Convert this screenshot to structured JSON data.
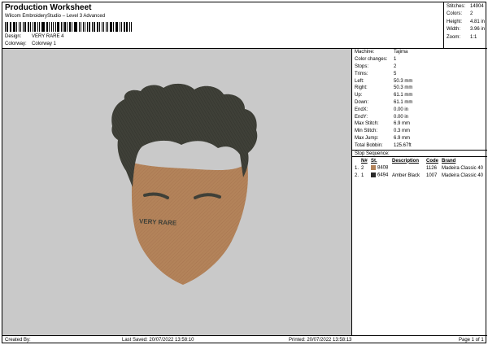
{
  "header": {
    "title": "Production Worksheet",
    "subtitle": "Wilcom EmbroideryStudio – Level 3 Advanced",
    "design_label": "Design:",
    "design_value": "VERY RARE 4",
    "colorway_label": "Colorway:",
    "colorway_value": "Colorway 1"
  },
  "summary": [
    {
      "label": "Stitches:",
      "value": "14904"
    },
    {
      "label": "Colors:",
      "value": "2"
    },
    {
      "label": "Height:",
      "value": "4.81 in"
    },
    {
      "label": "Width:",
      "value": "3.96 in"
    },
    {
      "label": "Zoom:",
      "value": "1:1"
    }
  ],
  "details": [
    {
      "label": "Machine:",
      "value": "Tajima"
    },
    {
      "label": "Color changes:",
      "value": "1"
    },
    {
      "label": "Stops:",
      "value": "2"
    },
    {
      "label": "Trims:",
      "value": "5"
    },
    {
      "label": "Left:",
      "value": "50.3 mm"
    },
    {
      "label": "Right:",
      "value": "50.3 mm"
    },
    {
      "label": "Up:",
      "value": "61.1 mm"
    },
    {
      "label": "Down:",
      "value": "61.1 mm"
    },
    {
      "label": "EndX:",
      "value": "0.00 in"
    },
    {
      "label": "EndY:",
      "value": "0.00 in"
    },
    {
      "label": "Max Stitch:",
      "value": "6.9 mm"
    },
    {
      "label": "Min Stitch:",
      "value": "0.3 mm"
    },
    {
      "label": "Max Jump:",
      "value": "6.9 mm"
    },
    {
      "label": "Total Bobbin:",
      "value": "125.67ft"
    }
  ],
  "stop_sequence": {
    "title": "Stop Sequence:",
    "columns": [
      "",
      "N#",
      "St.",
      "Description",
      "Code",
      "Brand"
    ],
    "rows": [
      {
        "idx": "1.",
        "num": "2",
        "color": "#b3835a",
        "code_num": "8408",
        "stitches": "1126",
        "description": "",
        "code": "Madeira Classic 40",
        "brand": ""
      },
      {
        "idx": "2.",
        "num": "1",
        "color": "#2a2a2a",
        "code_num": "6494",
        "stitches": "1007",
        "description": "Amber Black",
        "code": "Madeira Classic 40",
        "brand": ""
      }
    ]
  },
  "design_text": "VERY RARE",
  "colors": {
    "background": "#c9c9c9",
    "skin": "#b3835a",
    "hair": "#3f4038"
  },
  "footer": {
    "created_by": "Created By:",
    "last_saved": "Last Saved: 20/07/2022 13:58:10",
    "printed": "Printed: 20/07/2022 13:58:13",
    "page": "Page 1 of 1"
  }
}
